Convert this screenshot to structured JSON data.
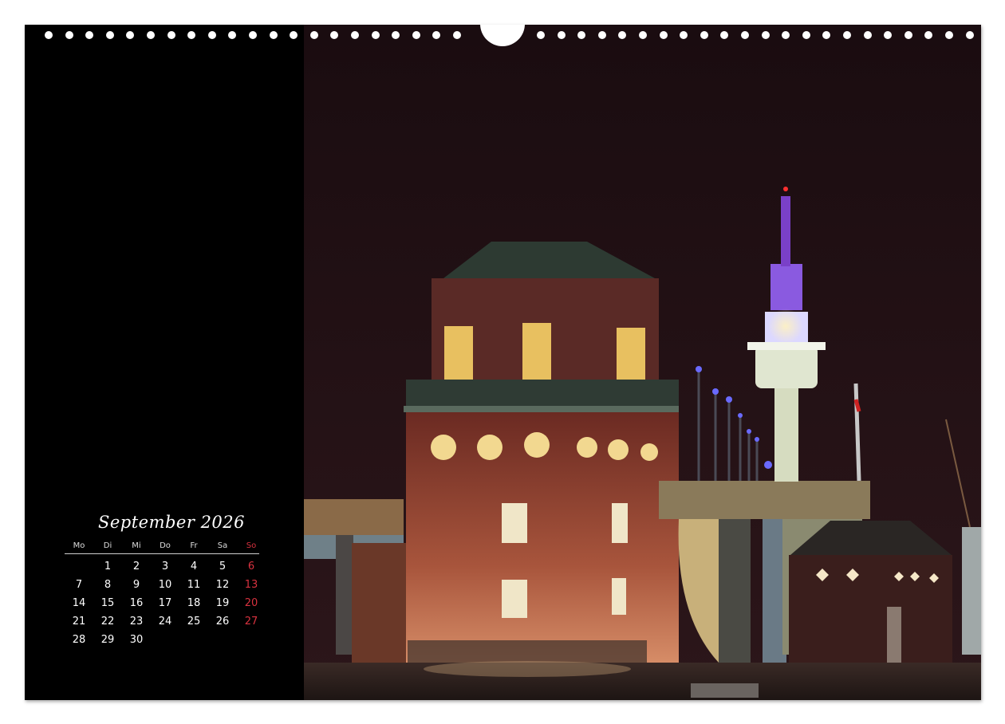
{
  "calendar": {
    "month_title": "September 2026",
    "weekdays": [
      "Mo",
      "Di",
      "Mi",
      "Do",
      "Fr",
      "Sa",
      "So"
    ],
    "leading_blanks": 1,
    "days": [
      "1",
      "2",
      "3",
      "4",
      "5",
      "6",
      "7",
      "8",
      "9",
      "10",
      "11",
      "12",
      "13",
      "14",
      "15",
      "16",
      "17",
      "18",
      "19",
      "20",
      "21",
      "22",
      "23",
      "24",
      "25",
      "26",
      "27",
      "28",
      "29",
      "30"
    ]
  },
  "colors": {
    "sunday": "#d8323f",
    "page_background": "#000000",
    "sky": "#1d0f12"
  }
}
